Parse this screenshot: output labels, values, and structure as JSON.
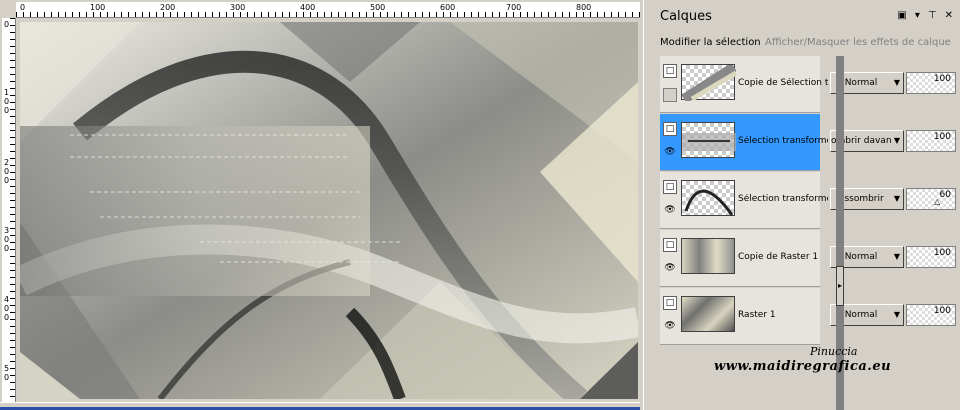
{
  "ruler": {
    "top_ticks": [
      "0",
      "100",
      "200",
      "300",
      "400",
      "500",
      "600",
      "700",
      "800"
    ],
    "left_ticks": [
      "0",
      "1\n0\n0",
      "2\n0\n0",
      "3\n0\n0",
      "4\n0\n0",
      "5\n0"
    ]
  },
  "panel": {
    "title": "Calques",
    "actions": {
      "modify_selection": "Modifier la sélection",
      "toggle_effects": "Afficher/Masquer les effets de calque"
    }
  },
  "layers": [
    {
      "name": "Copie de Sélection tr",
      "blend": "Normal",
      "opacity": 100,
      "selected": false,
      "visible": false
    },
    {
      "name": "Sélection transformé",
      "blend": "ombrir davant",
      "opacity": 100,
      "selected": true,
      "visible": true
    },
    {
      "name": "Sélection transformé",
      "blend": "Assombrir",
      "opacity": 60,
      "selected": false,
      "visible": true
    },
    {
      "name": "Copie de Raster 1",
      "blend": "Normal",
      "opacity": 100,
      "selected": false,
      "visible": true
    },
    {
      "name": "Raster 1",
      "blend": "Normal",
      "opacity": 100,
      "selected": false,
      "visible": true
    }
  ],
  "watermark": {
    "line1": "Pinuccia",
    "line2": "www.maidiregrafica.eu"
  },
  "icons": {
    "layer_type": "layer-page-icon",
    "visibility": "eye-icon",
    "dropdown": "chevron-down-icon"
  }
}
